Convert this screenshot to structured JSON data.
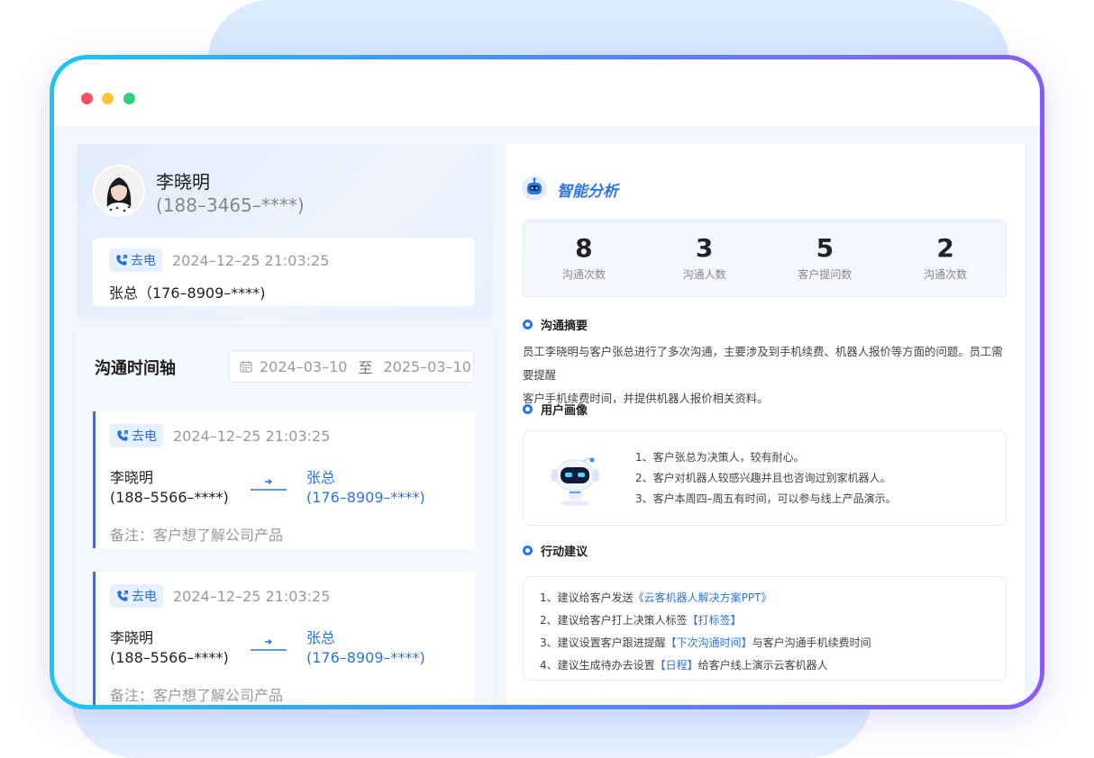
{
  "profile": {
    "name": "李晓明",
    "phone": "(188–3465–****)"
  },
  "latest_call": {
    "tag": "去电",
    "time": "2024–12–25 21:03:25",
    "contact": "张总（176–8909–****)"
  },
  "timeline": {
    "title": "沟通时间轴",
    "date_from": "2024–03–10",
    "date_sep": "至",
    "date_to": "2025–03–10",
    "items": [
      {
        "tag": "去电",
        "time": "2024–12–25 21:03:25",
        "from_name": "李晓明",
        "from_phone": "(188–5566–****)",
        "to_name": "张总",
        "to_phone": "(176–8909–****)",
        "remark": "备注：客户想了解公司产品"
      },
      {
        "tag": "去电",
        "time": "2024–12–25 21:03:25",
        "from_name": "李晓明",
        "from_phone": "(188–5566–****)",
        "to_name": "张总",
        "to_phone": "(176–8909–****)",
        "remark": "备注：客户想了解公司产品"
      }
    ]
  },
  "analysis": {
    "title": "智能分析",
    "stats": [
      {
        "value": "8",
        "label": "沟通次数"
      },
      {
        "value": "3",
        "label": "沟通人数"
      },
      {
        "value": "5",
        "label": "客户提问数"
      },
      {
        "value": "2",
        "label": "沟通次数"
      }
    ],
    "summary_title": "沟通摘要",
    "summary_line1": "员工李晓明与客户张总进行了多次沟通，主要涉及到手机续费、机器人报价等方面的问题。员工需要提醒",
    "summary_line2": "客户手机续费时间，并提供机器人报价相关资料。",
    "persona_title": "用户画像",
    "persona_items": [
      "1、客户张总为决策人，较有耐心。",
      "2、客户对机器人较感兴趣并且也咨询过别家机器人。",
      "3、客户本周四–周五有时间，可以参与线上产品演示。"
    ],
    "actions_title": "行动建议",
    "actions": [
      {
        "pre": "1、建议给客户发送",
        "link": "《云客机器人解决方案PPT》",
        "post": ""
      },
      {
        "pre": "2、建议给客户打上决策人标签",
        "link": "【打标签】",
        "post": ""
      },
      {
        "pre": "3、建议设置客户跟进提醒",
        "link": "【下次沟通时间】",
        "post": "与客户沟通手机续费时间"
      },
      {
        "pre": "4、建议生成待办去设置",
        "link": "【日程】",
        "post": "给客户线上演示云客机器人"
      }
    ]
  },
  "colors": {
    "accent": "#2b74e2",
    "frame_start": "#1fc4f2",
    "frame_end": "#8a5cf6",
    "dot_red": "#f5515f",
    "dot_yellow": "#f8c62d",
    "dot_green": "#2ed07b"
  },
  "icons": [
    "phone-icon",
    "calendar-icon",
    "arrow-right-icon",
    "robot-icon",
    "section-dot-icon",
    "avatar-photo"
  ]
}
